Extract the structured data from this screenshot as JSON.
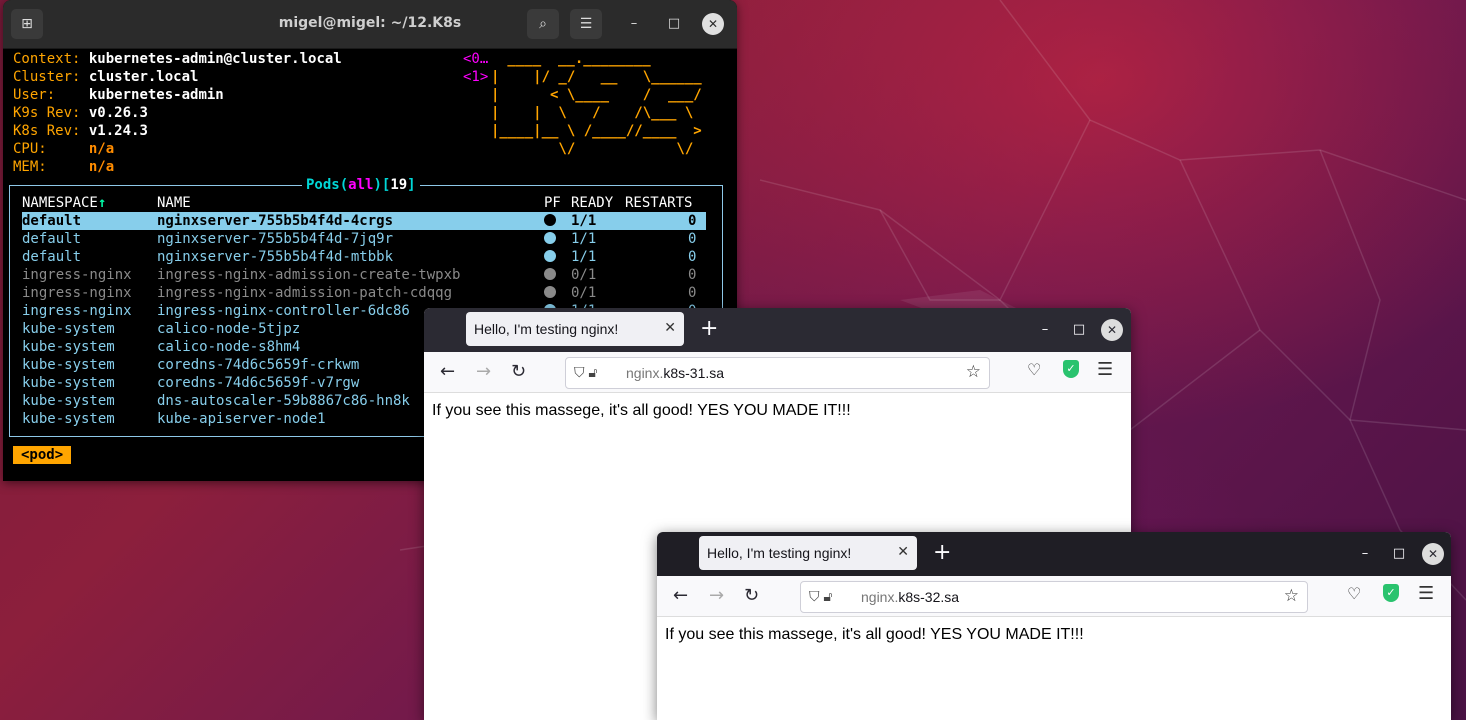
{
  "terminal": {
    "title": "migel@migel: ~/12.K8s",
    "info": [
      {
        "label": "Context:",
        "value": "kubernetes-admin@cluster.local"
      },
      {
        "label": "Cluster:",
        "value": "cluster.local"
      },
      {
        "label": "User:",
        "value": "kubernetes-admin"
      },
      {
        "label": "K9s Rev:",
        "value": "v0.26.3"
      },
      {
        "label": "K8s Rev:",
        "value": "v1.24.3"
      },
      {
        "label": "CPU:",
        "value": "n/a"
      },
      {
        "label": "MEM:",
        "value": "n/a"
      }
    ],
    "hotkeys": [
      "<0…",
      "<1>"
    ],
    "logo": [
      " ____  __.________       ",
      "|    |/ _/   __   \\______",
      "|      < \\____    /  ___/",
      "|    |  \\   /    /\\___ \\ ",
      "|____|__ \\ /____//____  >",
      "        \\/            \\/ "
    ],
    "pods_title": {
      "prefix": "Pods(",
      "filter": "all",
      "suffix": ")[",
      "count": "19",
      "end": "]"
    },
    "columns": {
      "namespace": "NAMESPACE",
      "sort_arrow": "↑",
      "name": "NAME",
      "pf": "PF",
      "ready": "READY",
      "restarts": "RESTARTS"
    },
    "pods": [
      {
        "namespace": "default",
        "name": "nginxserver-755b5b4f4d-4crgs",
        "ready": "1/1",
        "restarts": "0"
      },
      {
        "namespace": "default",
        "name": "nginxserver-755b5b4f4d-7jq9r",
        "ready": "1/1",
        "restarts": "0"
      },
      {
        "namespace": "default",
        "name": "nginxserver-755b5b4f4d-mtbbk",
        "ready": "1/1",
        "restarts": "0"
      },
      {
        "namespace": "ingress-nginx",
        "name": "ingress-nginx-admission-create-twpxb",
        "ready": "0/1",
        "restarts": "0"
      },
      {
        "namespace": "ingress-nginx",
        "name": "ingress-nginx-admission-patch-cdqqg",
        "ready": "0/1",
        "restarts": "0"
      },
      {
        "namespace": "ingress-nginx",
        "name": "ingress-nginx-controller-6dc86",
        "ready": "1/1",
        "restarts": "0"
      },
      {
        "namespace": "kube-system",
        "name": "calico-node-5tjpz",
        "ready": "",
        "restarts": ""
      },
      {
        "namespace": "kube-system",
        "name": "calico-node-s8hm4",
        "ready": "",
        "restarts": ""
      },
      {
        "namespace": "kube-system",
        "name": "coredns-74d6c5659f-crkwm",
        "ready": "",
        "restarts": ""
      },
      {
        "namespace": "kube-system",
        "name": "coredns-74d6c5659f-v7rgw",
        "ready": "",
        "restarts": ""
      },
      {
        "namespace": "kube-system",
        "name": "dns-autoscaler-59b8867c86-hn8k",
        "ready": "",
        "restarts": ""
      },
      {
        "namespace": "kube-system",
        "name": "kube-apiserver-node1",
        "ready": "",
        "restarts": ""
      }
    ],
    "crumb": "<pod>",
    "colors": {
      "orange": "#ffa500",
      "cyan": "#00d7d7",
      "magenta": "#ff00ff",
      "selection": "#87ceeb"
    }
  },
  "browser1": {
    "tab_title": "Hello, I'm testing nginx!",
    "url_sub": "nginx.",
    "url_domain": "k8s-31.sa",
    "body_text": "If you see this massege, it's all good! YES YOU MADE IT!!!"
  },
  "browser2": {
    "tab_title": "Hello, I'm testing nginx!",
    "url_sub": "nginx.",
    "url_domain": "k8s-32.sa",
    "body_text": "If you see this massege, it's all good! YES YOU MADE IT!!!"
  },
  "icons": {
    "new_tab": "+",
    "close": "✕",
    "back": "←",
    "forward": "→",
    "reload": "↻",
    "star": "☆",
    "menu": "☰",
    "minimize": "–",
    "maximize": "□"
  }
}
